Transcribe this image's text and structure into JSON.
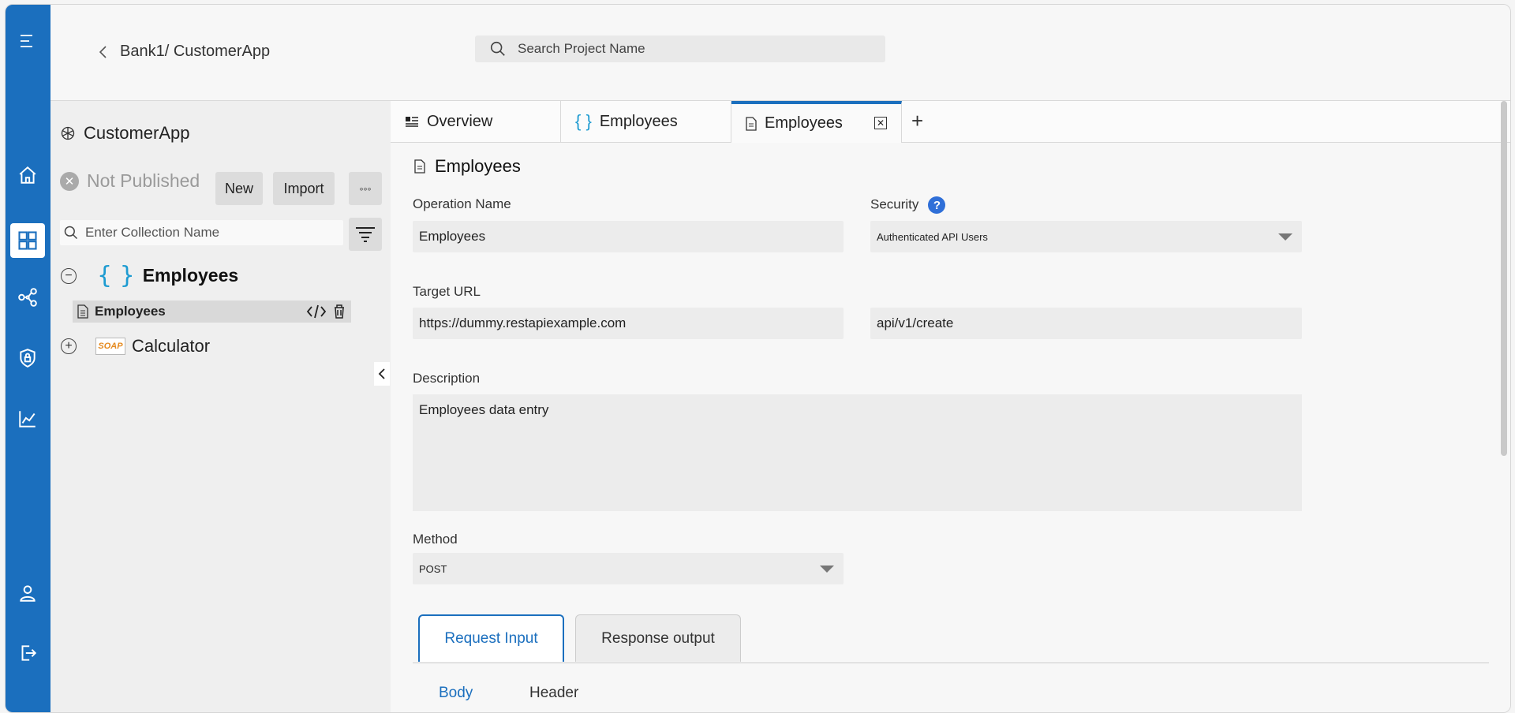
{
  "header": {
    "breadcrumb": "Bank1/ CustomerApp",
    "search_placeholder": "Search Project Name"
  },
  "sidebar": {
    "project_name": "CustomerApp",
    "status": "Not Published",
    "new_label": "New",
    "import_label": "Import",
    "more_label": "◦◦◦",
    "collection_placeholder": "Enter Collection Name",
    "tree": [
      {
        "label": "Employees",
        "type": "rest",
        "expanded": true,
        "children": [
          {
            "label": "Employees"
          }
        ]
      },
      {
        "label": "Calculator",
        "type": "soap",
        "badge": "SOAP",
        "expanded": false
      }
    ]
  },
  "tabs": [
    {
      "label": "Overview"
    },
    {
      "label": "Employees"
    },
    {
      "label": "Employees",
      "active": true
    }
  ],
  "form": {
    "title": "Employees",
    "operation_name_label": "Operation Name",
    "operation_name": "Employees",
    "security_label": "Security",
    "security_help": "?",
    "security_value": "Authenticated API Users",
    "target_url_label": "Target URL",
    "target_url": "https://dummy.restapiexample.com",
    "target_path": "api/v1/create",
    "description_label": "Description",
    "description": "Employees data entry",
    "method_label": "Method",
    "method": "POST"
  },
  "io_tabs": {
    "request": "Request Input",
    "response": "Response output"
  },
  "sub_tabs": {
    "body": "Body",
    "header": "Header"
  },
  "colors": {
    "rail": "#1b6fbe",
    "accent": "#1b6fbe",
    "brace": "#1d9bd1",
    "soap": "#e58a1f",
    "help": "#2f6fd8"
  }
}
